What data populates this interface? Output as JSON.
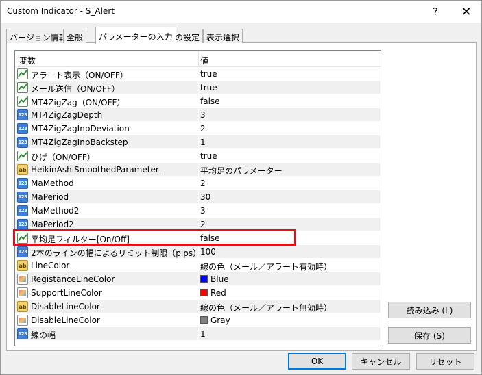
{
  "window": {
    "title": "Custom Indicator - S_Alert",
    "help_glyph": "?",
    "close_glyph": "✕"
  },
  "tabs": [
    {
      "label": "バージョン情報"
    },
    {
      "label": "全般"
    },
    {
      "label": "パラメーターの入力"
    },
    {
      "label": "色の設定"
    },
    {
      "label": "表示選択"
    }
  ],
  "table": {
    "header_name": "変数",
    "header_value": "値",
    "rows": [
      {
        "type": "bool",
        "name": "アラート表示（ON/OFF）",
        "value": "true"
      },
      {
        "type": "bool",
        "name": "メール送信（ON/OFF）",
        "value": "true"
      },
      {
        "type": "bool",
        "name": "MT4ZigZag（ON/OFF）",
        "value": "false"
      },
      {
        "type": "int",
        "name": "MT4ZigZagDepth",
        "value": "3"
      },
      {
        "type": "int",
        "name": "MT4ZigZagInpDeviation",
        "value": "2"
      },
      {
        "type": "int",
        "name": "MT4ZigZagInpBackstep",
        "value": "1"
      },
      {
        "type": "bool",
        "name": "ひげ（ON/OFF）",
        "value": "true"
      },
      {
        "type": "str",
        "name": "HeikinAshiSmoothedParameter_",
        "value": "平均足のパラメーター"
      },
      {
        "type": "int",
        "name": "MaMethod",
        "value": "2"
      },
      {
        "type": "int",
        "name": "MaPeriod",
        "value": "30"
      },
      {
        "type": "int",
        "name": "MaMethod2",
        "value": "3"
      },
      {
        "type": "int",
        "name": "MaPeriod2",
        "value": "2"
      },
      {
        "type": "bool",
        "name": "平均足フィルター[On/Off]",
        "value": "false"
      },
      {
        "type": "int",
        "name": "2本のラインの幅によるリミット制限（pips）",
        "value": "100"
      },
      {
        "type": "str",
        "name": "LineColor_",
        "value": "線の色（メール／アラート有効時）"
      },
      {
        "type": "color",
        "name": "RegistanceLineColor",
        "value": "Blue",
        "swatch": "#0000ff"
      },
      {
        "type": "color",
        "name": "SupportLineColor",
        "value": "Red",
        "swatch": "#ff0000"
      },
      {
        "type": "str",
        "name": "DisableLineColor_",
        "value": "線の色（メール／アラート無効時）"
      },
      {
        "type": "color",
        "name": "DisableLineColor",
        "value": "Gray",
        "swatch": "#808080"
      },
      {
        "type": "int",
        "name": "線の幅",
        "value": "1"
      }
    ]
  },
  "icons": {
    "int_text": "123",
    "str_text": "ab"
  },
  "buttons": {
    "load": "読み込み (L)",
    "save": "保存 (S)",
    "ok": "OK",
    "cancel": "キャンセル",
    "reset": "リセット"
  }
}
